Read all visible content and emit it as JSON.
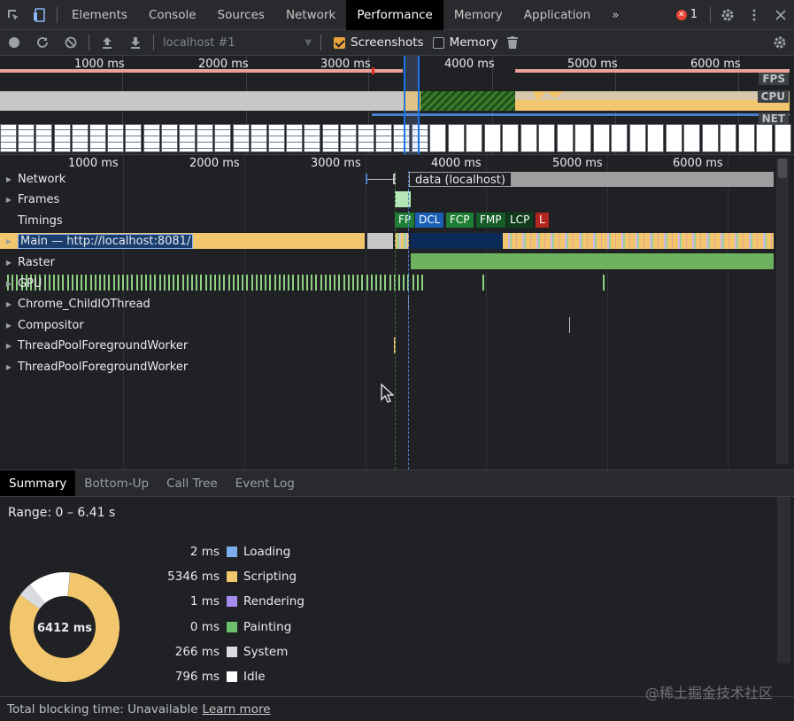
{
  "tabs": [
    {
      "label": "Elements"
    },
    {
      "label": "Console"
    },
    {
      "label": "Sources"
    },
    {
      "label": "Network"
    },
    {
      "label": "Performance",
      "active": true
    },
    {
      "label": "Memory"
    },
    {
      "label": "Application"
    }
  ],
  "more_tabs": "»",
  "error_count": "1",
  "toolbar": {
    "profile": "localhost #1",
    "screenshots_label": "Screenshots",
    "screenshots_checked": true,
    "memory_label": "Memory",
    "memory_checked": false
  },
  "overview": {
    "ticks": [
      "1000 ms",
      "2000 ms",
      "3000 ms",
      "4000 ms",
      "5000 ms",
      "6000 ms"
    ],
    "lanes": {
      "fps": "FPS",
      "cpu": "CPU",
      "net": "NET"
    }
  },
  "flame": {
    "ticks": [
      "1000 ms",
      "2000 ms",
      "3000 ms",
      "4000 ms",
      "5000 ms",
      "6000 ms"
    ],
    "tracks": [
      {
        "label": "Network",
        "arrow": true
      },
      {
        "label": "Frames",
        "arrow": true
      },
      {
        "label": "Timings",
        "arrow": false
      },
      {
        "label": "Main — http://localhost:8081/",
        "arrow": true,
        "selected": true
      },
      {
        "label": "Raster",
        "arrow": true
      },
      {
        "label": "GPU",
        "arrow": true
      },
      {
        "label": "Chrome_ChildIOThread",
        "arrow": true
      },
      {
        "label": "Compositor",
        "arrow": true
      },
      {
        "label": "ThreadPoolForegroundWorker",
        "arrow": true
      },
      {
        "label": "ThreadPoolForegroundWorker",
        "arrow": true
      }
    ],
    "network_request": "data (localhost)",
    "markers": [
      {
        "label": "FP",
        "color": "#1e7e34"
      },
      {
        "label": "DCL",
        "color": "#1a5fb4"
      },
      {
        "label": "FCP",
        "color": "#1e7e34"
      },
      {
        "label": "FMP",
        "color": "#155d27"
      },
      {
        "label": "LCP",
        "color": "#0f3d1c"
      },
      {
        "label": "L",
        "color": "#b3261e"
      }
    ]
  },
  "bottom_tabs": [
    "Summary",
    "Bottom-Up",
    "Call Tree",
    "Event Log"
  ],
  "summary": {
    "range": "Range: 0 – 6.41 s",
    "total": "6412 ms",
    "categories": [
      {
        "value": "2 ms",
        "label": "Loading",
        "color": "#7cadea",
        "ms": 2
      },
      {
        "value": "5346 ms",
        "label": "Scripting",
        "color": "#f2c66d",
        "ms": 5346
      },
      {
        "value": "1 ms",
        "label": "Rendering",
        "color": "#a78cf0",
        "ms": 1
      },
      {
        "value": "0 ms",
        "label": "Painting",
        "color": "#6cbf6b",
        "ms": 0
      },
      {
        "value": "266 ms",
        "label": "System",
        "color": "#dadce0",
        "ms": 266
      },
      {
        "value": "796 ms",
        "label": "Idle",
        "color": "#ffffff",
        "ms": 796
      }
    ]
  },
  "footer": {
    "tbt": "Total blocking time: Unavailable",
    "learn_more": "Learn more"
  },
  "watermark": "@稀土掘金技术社区"
}
